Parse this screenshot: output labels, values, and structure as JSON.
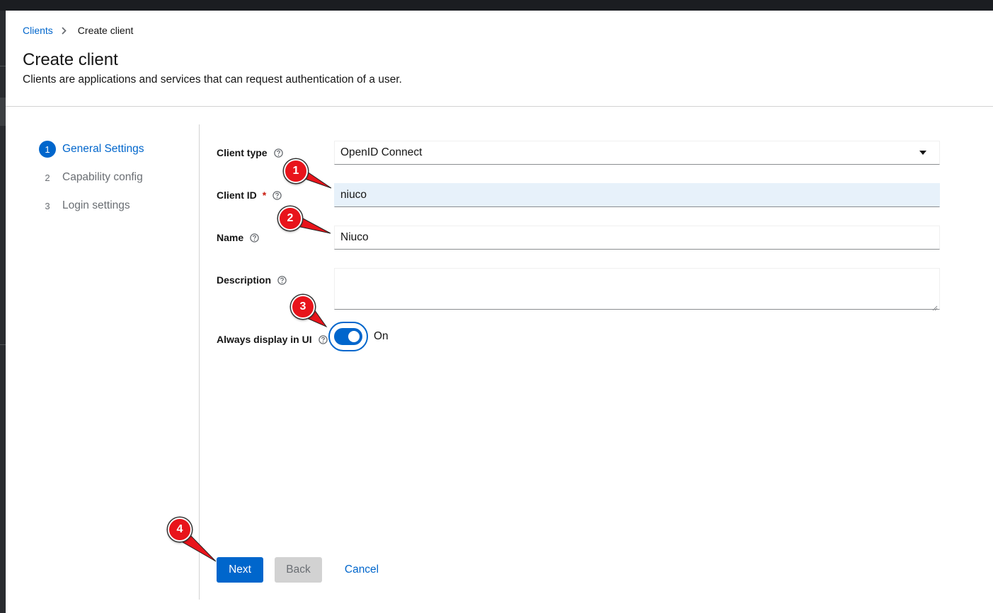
{
  "breadcrumb": {
    "parent": "Clients",
    "current": "Create client"
  },
  "page": {
    "title": "Create client",
    "subtitle": "Clients are applications and services that can request authentication of a user."
  },
  "wizard": {
    "steps": [
      {
        "number": "1",
        "label": "General Settings",
        "active": true
      },
      {
        "number": "2",
        "label": "Capability config",
        "active": false
      },
      {
        "number": "3",
        "label": "Login settings",
        "active": false
      }
    ]
  },
  "form": {
    "client_type": {
      "label": "Client type",
      "value": "OpenID Connect"
    },
    "client_id": {
      "label": "Client ID",
      "required_mark": "*",
      "value": "niuco"
    },
    "name": {
      "label": "Name",
      "value": "Niuco"
    },
    "description": {
      "label": "Description",
      "value": ""
    },
    "always_display": {
      "label": "Always display in UI",
      "state": "On",
      "checked": true
    }
  },
  "buttons": {
    "next": "Next",
    "back": "Back",
    "cancel": "Cancel"
  },
  "annotations": [
    "1",
    "2",
    "3",
    "4"
  ],
  "colors": {
    "primary": "#0066cc",
    "callout": "#e8141b",
    "required": "#c9190b"
  }
}
